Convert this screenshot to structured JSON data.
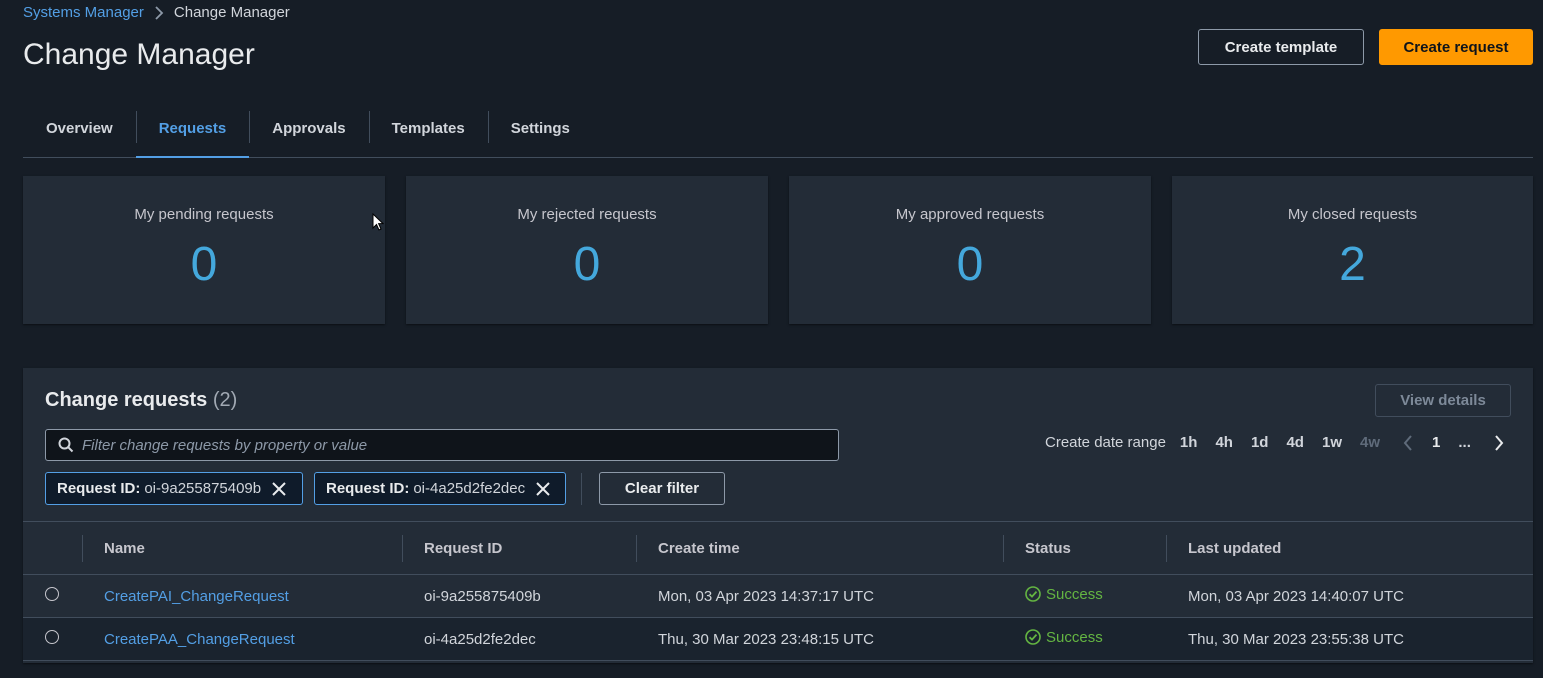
{
  "breadcrumb": {
    "root": "Systems Manager",
    "current": "Change Manager"
  },
  "page": {
    "title": "Change Manager"
  },
  "actions": {
    "create_template": "Create template",
    "create_request": "Create request"
  },
  "tabs": [
    {
      "label": "Overview",
      "active": false
    },
    {
      "label": "Requests",
      "active": true
    },
    {
      "label": "Approvals",
      "active": false
    },
    {
      "label": "Templates",
      "active": false
    },
    {
      "label": "Settings",
      "active": false
    }
  ],
  "stats": [
    {
      "label": "My pending requests",
      "value": "0"
    },
    {
      "label": "My rejected requests",
      "value": "0"
    },
    {
      "label": "My approved requests",
      "value": "0"
    },
    {
      "label": "My closed requests",
      "value": "2"
    }
  ],
  "panel": {
    "title": "Change requests",
    "count": "(2)",
    "view_details": "View details",
    "search_placeholder": "Filter change requests by property or value",
    "date_range": {
      "label": "Create date range",
      "options": [
        "1h",
        "4h",
        "1d",
        "4d",
        "1w",
        "4w"
      ],
      "disabled_option": "4w"
    },
    "pagination": {
      "current_page": "1",
      "ellipsis": "..."
    },
    "tokens": [
      {
        "key": "Request ID:",
        "value": "oi-9a255875409b"
      },
      {
        "key": "Request ID:",
        "value": "oi-4a25d2fe2dec"
      }
    ],
    "clear_filter": "Clear filter",
    "columns": [
      "Name",
      "Request ID",
      "Create time",
      "Status",
      "Last updated"
    ],
    "rows": [
      {
        "name": "CreatePAI_ChangeRequest",
        "request_id": "oi-9a255875409b",
        "create_time": "Mon, 03 Apr 2023 14:37:17 UTC",
        "status": "Success",
        "last_updated": "Mon, 03 Apr 2023 14:40:07 UTC"
      },
      {
        "name": "CreatePAA_ChangeRequest",
        "request_id": "oi-4a25d2fe2dec",
        "create_time": "Thu, 30 Mar 2023 23:48:15 UTC",
        "status": "Success",
        "last_updated": "Thu, 30 Mar 2023 23:55:38 UTC"
      }
    ]
  },
  "colors": {
    "background": "#161d26",
    "card": "#232c37",
    "link": "#539fe5",
    "primary_button": "#ff9900",
    "stat_value": "#44a8dc",
    "success": "#64b542"
  }
}
